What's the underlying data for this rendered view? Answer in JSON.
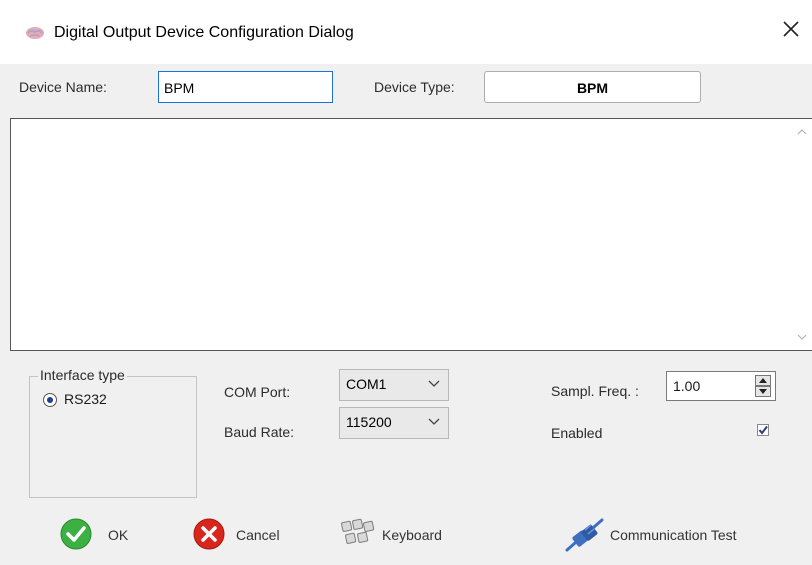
{
  "window": {
    "title": "Digital Output Device Configuration Dialog",
    "close_icon": "close-icon",
    "app_icon": "brain-icon"
  },
  "device": {
    "name_label": "Device Name:",
    "name_value": "BPM",
    "type_label": "Device Type:",
    "type_value": "BPM"
  },
  "interface": {
    "legend": "Interface type",
    "option_rs232": "RS232",
    "selected": "RS232"
  },
  "com": {
    "port_label": "COM Port:",
    "port_value": "COM1",
    "baud_label": "Baud Rate:",
    "baud_value": "115200"
  },
  "sampling": {
    "freq_label": "Sampl. Freq. :",
    "freq_value": "1.00",
    "enabled_label": "Enabled",
    "enabled": true
  },
  "buttons": {
    "ok": "OK",
    "cancel": "Cancel",
    "keyboard": "Keyboard",
    "comm_test": "Communication Test"
  },
  "colors": {
    "accent": "#1e6fd6",
    "ok_green": "#3cb043",
    "cancel_red": "#d9261c",
    "background": "#f0f0f0"
  }
}
